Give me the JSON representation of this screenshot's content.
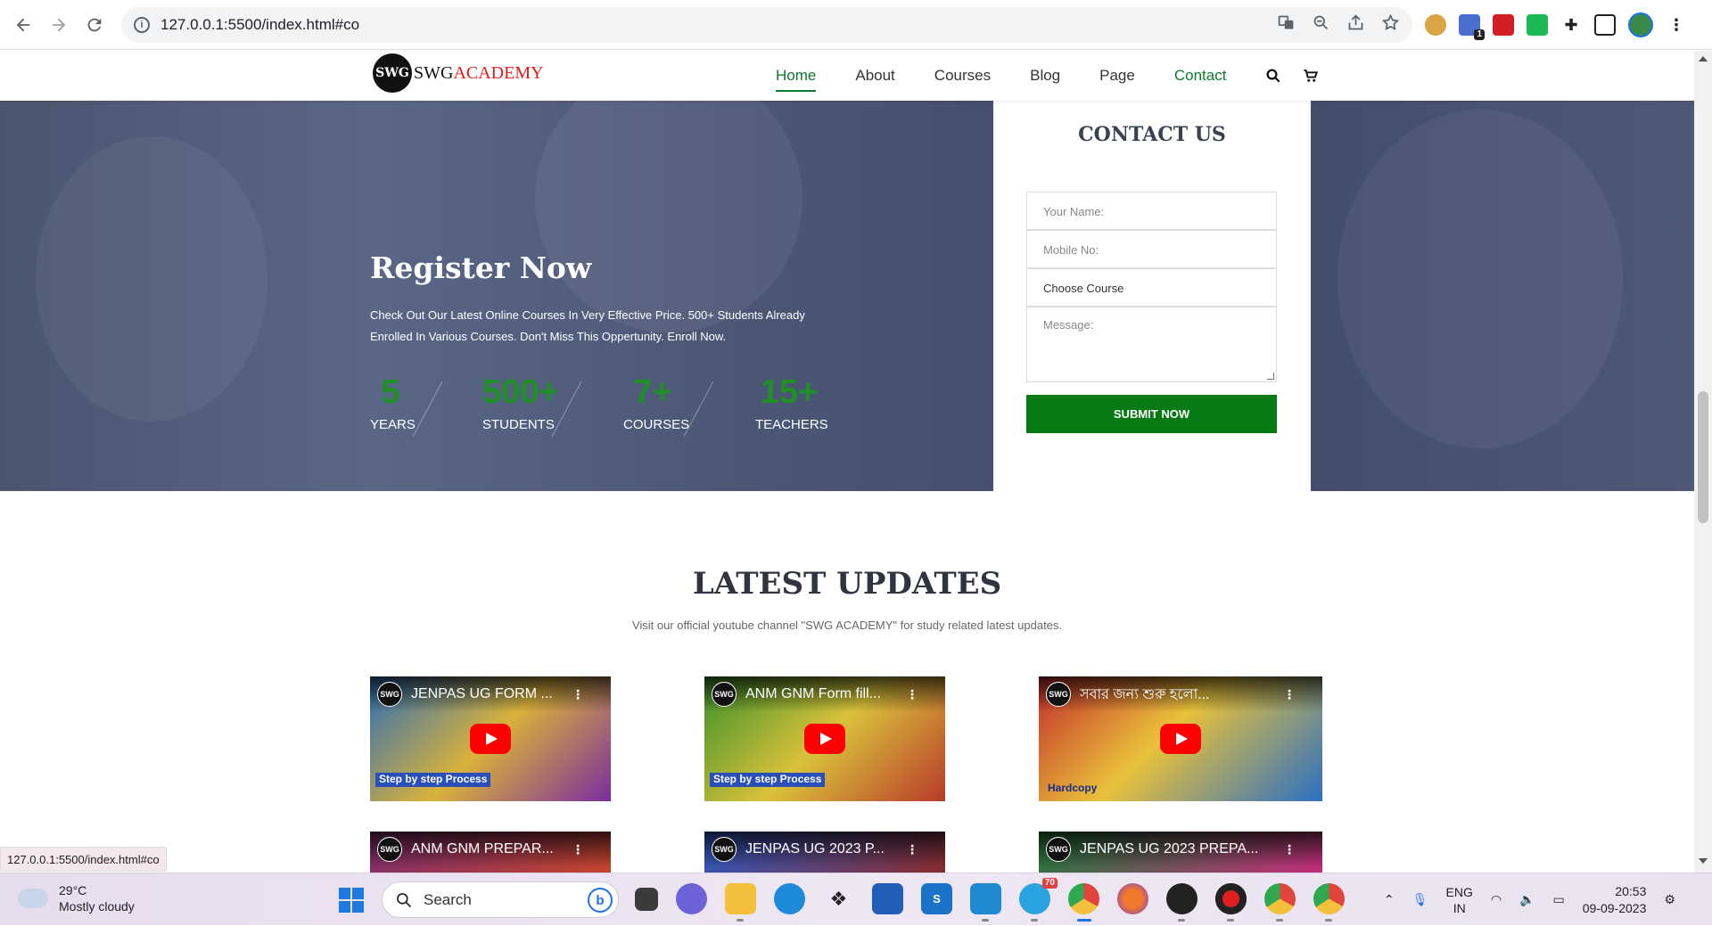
{
  "browser": {
    "url": "127.0.0.1:5500/index.html#co",
    "status_url": "127.0.0.1:5500/index.html#co",
    "extension_badge": "1"
  },
  "site": {
    "logo_badge": "SWG",
    "logo_text_a": "SWG",
    "logo_text_b": "ACADEMY",
    "menu": [
      "Home",
      "About",
      "Courses",
      "Blog",
      "Page",
      "Contact"
    ]
  },
  "hero": {
    "title": "Register Now",
    "description": "Check Out Our Latest Online Courses In Very Effective Price. 500+ Students Already Enrolled In Various Courses. Don't Miss This Oppertunity. Enroll Now.",
    "stats": [
      {
        "num": "5",
        "label": "YEARS"
      },
      {
        "num": "500+",
        "label": "STUDENTS"
      },
      {
        "num": "7+",
        "label": "COURSES"
      },
      {
        "num": "15+",
        "label": "TEACHERS"
      }
    ]
  },
  "contact": {
    "title": "CONTACT US",
    "name_placeholder": "Your Name:",
    "mobile_placeholder": "Mobile No:",
    "course_select": "Choose Course",
    "message_placeholder": "Message:",
    "submit": "SUBMIT NOW"
  },
  "updates": {
    "title": "LATEST UPDATES",
    "subtitle": "Visit our official youtube channel \"SWG ACADEMY\" for study related latest updates.",
    "videos": [
      {
        "title": "JENPAS UG FORM ...",
        "strip": "Step by step Process",
        "color_a": "#2a6cb8",
        "color_b": "#7a2c9e"
      },
      {
        "title": "ANM GNM Form fill...",
        "strip": "Step by step Process",
        "color_a": "#3a8f2a",
        "color_b": "#b83a2a"
      },
      {
        "title": "সবার জন্য শুরু হলো...",
        "strip": "Hardcopy",
        "color_a": "#c42b2b",
        "color_b": "#2b6fc4"
      },
      {
        "title": "ANM GNM PREPAR...",
        "strip": "",
        "color_a": "#7a2c6e",
        "color_b": "#c4442b"
      },
      {
        "title": "JENPAS UG 2023 P...",
        "strip": "",
        "color_a": "#2b5ac4",
        "color_b": "#8a2b2b"
      },
      {
        "title": "JENPAS UG 2023 PREPA...",
        "strip": "",
        "color_a": "#1f7a3a",
        "color_b": "#c42b7a"
      }
    ]
  },
  "taskbar": {
    "temp": "29°C",
    "weather": "Mostly cloudy",
    "search": "Search",
    "lang_a": "ENG",
    "lang_b": "IN",
    "time": "20:53",
    "date": "09-09-2023",
    "telegram_badge": "70"
  },
  "colors": {
    "accent_green": "#0d7a2c",
    "submit_green": "#087a14",
    "stat_green": "#1f8f26",
    "logo_red": "#e21b1b"
  }
}
